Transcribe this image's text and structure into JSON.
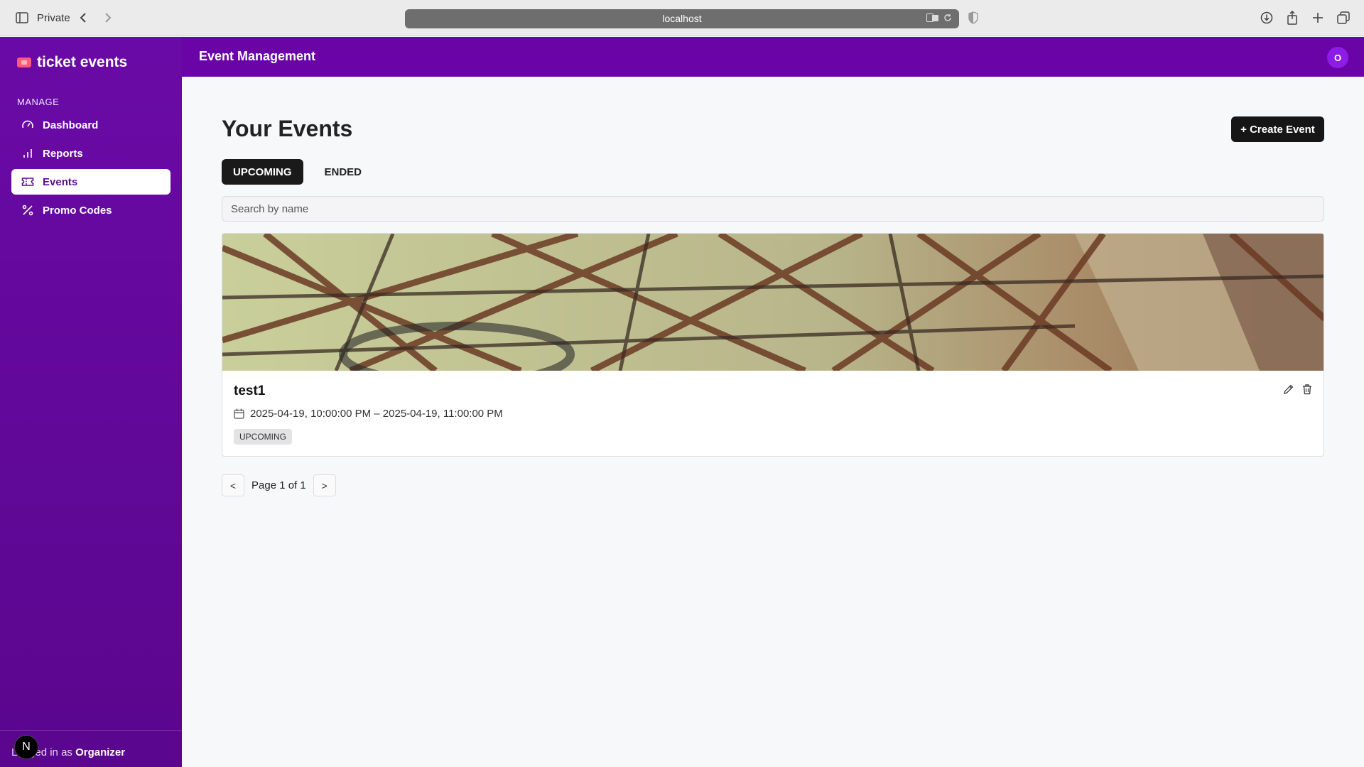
{
  "browser": {
    "private_label": "Private",
    "url": "localhost"
  },
  "brand": {
    "name": "ticket events"
  },
  "sidebar": {
    "section_label": "MANAGE",
    "items": [
      {
        "label": "Dashboard",
        "icon": "gauge-icon",
        "active": false
      },
      {
        "label": "Reports",
        "icon": "bar-chart-icon",
        "active": false
      },
      {
        "label": "Events",
        "icon": "ticket-icon",
        "active": true
      },
      {
        "label": "Promo Codes",
        "icon": "percent-icon",
        "active": false
      }
    ],
    "footer": {
      "prefix": "Logged in as ",
      "user": "Organizer",
      "badge": "N"
    }
  },
  "header": {
    "title": "Event Management",
    "avatar": "O"
  },
  "main": {
    "title": "Your Events",
    "create_button": "+ Create Event",
    "tabs": [
      {
        "label": "UPCOMING",
        "active": true
      },
      {
        "label": "ENDED",
        "active": false
      }
    ],
    "search_placeholder": "Search by name",
    "events": [
      {
        "name": "test1",
        "dates": "2025-04-19, 10:00:00 PM – 2025-04-19, 11:00:00 PM",
        "status": "UPCOMING"
      }
    ],
    "pagination": {
      "prev": "<",
      "label": "Page 1 of 1",
      "next": ">"
    }
  },
  "colors": {
    "brand_purple": "#6a04a6",
    "active_tab": "#1a1a1a",
    "logo_accent": "#ff5a78"
  }
}
